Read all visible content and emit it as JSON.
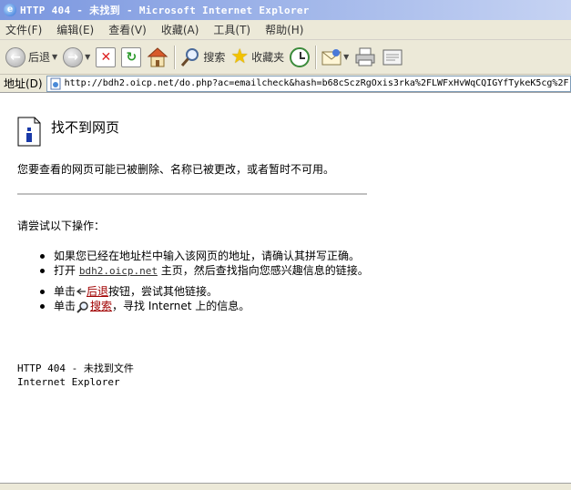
{
  "window": {
    "title": "HTTP 404 - 未找到 - Microsoft Internet Explorer"
  },
  "menu": {
    "items": [
      "文件(F)",
      "编辑(E)",
      "查看(V)",
      "收藏(A)",
      "工具(T)",
      "帮助(H)"
    ]
  },
  "toolbar": {
    "back_label": "后退",
    "search_label": "搜索",
    "favorites_label": "收藏夹"
  },
  "address": {
    "label": "地址(D)",
    "url": "http://bdh2.oicp.net/do.php?ac=emailcheck&hash=b68cSczRgOxis3rka%2FLWFxHvWqCQIGYfTykeK5cg%2F"
  },
  "content": {
    "heading": "找不到网页",
    "description": "您要查看的网页可能已被删除、名称已被更改，或者暂时不可用。",
    "try_label": "请尝试以下操作：",
    "item1": "如果您已经在地址栏中输入该网页的地址，请确认其拼写正确。",
    "item2_prefix": "打开",
    "item2_link": "bdh2.oicp.net",
    "item2_suffix": "主页，然后查找指向您感兴趣信息的链接。",
    "item3_prefix": "单击",
    "item3_link": "后退",
    "item3_suffix": "按钮，尝试其他链接。",
    "item4_prefix": "单击",
    "item4_link": "搜索",
    "item4_suffix": "，寻找 Internet 上的信息。",
    "footer_line1": "HTTP 404 - 未找到文件",
    "footer_line2": "Internet Explorer"
  }
}
